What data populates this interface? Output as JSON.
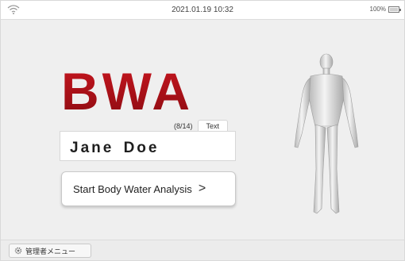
{
  "status_bar": {
    "datetime": "2021.01.19 10:32",
    "battery_percent": "100%",
    "icons": [
      "wifi-icon",
      "battery-icon"
    ]
  },
  "brand": {
    "logo_text": "BWA",
    "logo_color": "#b0121b"
  },
  "name_entry": {
    "char_count": "(8/14)",
    "input_mode_tab": "Text",
    "value": "Jane Doe"
  },
  "actions": {
    "start_label": "Start Body Water Analysis",
    "start_chevron": ">"
  },
  "bottom_bar": {
    "admin_menu_label": "管理者メニュー",
    "admin_icon": "gear-icon"
  },
  "figure": {
    "icon": "human-body-icon"
  }
}
